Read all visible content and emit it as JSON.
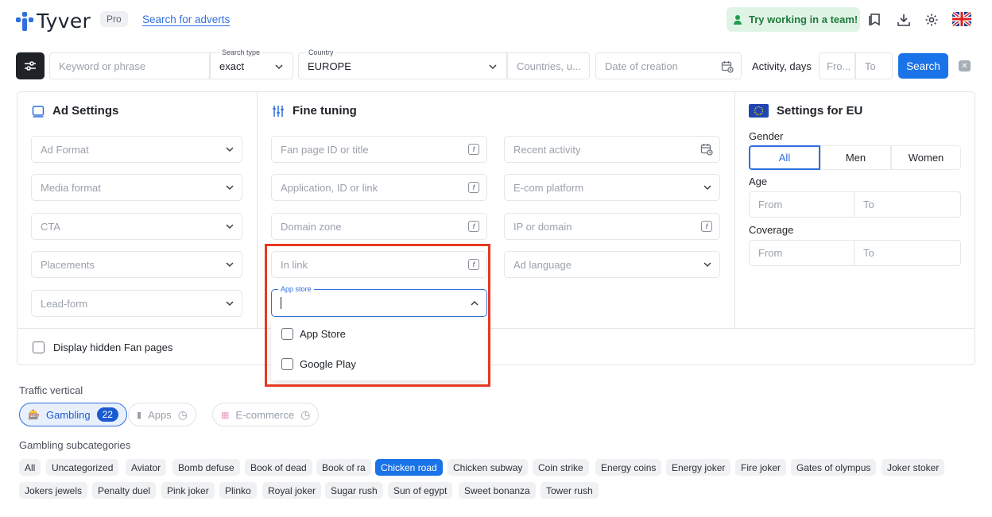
{
  "header": {
    "logo_text": "Tyver",
    "pro_badge": "Pro",
    "search_adverts_link": "Search for adverts",
    "team_button": "Try working in a team!",
    "icons": [
      "bookmark-icon",
      "download-icon",
      "gear-icon",
      "uk-flag-icon"
    ]
  },
  "search_bar": {
    "keyword_placeholder": "Keyword or phrase",
    "search_type_label": "Search type",
    "search_type_value": "exact",
    "country_label": "Country",
    "country_value": "EUROPE",
    "countries_placeholder": "Countries, u...",
    "date_placeholder": "Date of creation",
    "activity_label": "Activity, days",
    "activity_from": "Fro...",
    "activity_to": "To",
    "search_button": "Search"
  },
  "ad_settings": {
    "title": "Ad Settings",
    "fields": [
      "Ad Format",
      "Media format",
      "CTA",
      "Placements",
      "Lead-form"
    ]
  },
  "fine_tuning": {
    "title": "Fine tuning",
    "left_fields": [
      "Fan page ID or title",
      "Application, ID or link",
      "Domain zone",
      "In link"
    ],
    "right_fields": [
      "Recent activity",
      "E-com platform",
      "IP or domain",
      "Ad language"
    ],
    "app_store": {
      "label": "App store",
      "value": "",
      "options": [
        "App Store",
        "Google Play"
      ]
    }
  },
  "eu_settings": {
    "title": "Settings for EU",
    "gender_label": "Gender",
    "gender_options": [
      "All",
      "Men",
      "Women"
    ],
    "gender_selected": "All",
    "age_label": "Age",
    "age_from": "From",
    "age_to": "To",
    "coverage_label": "Coverage",
    "coverage_from": "From",
    "coverage_to": "To"
  },
  "hidden_fan_pages": "Display hidden Fan pages",
  "traffic": {
    "label": "Traffic vertical",
    "verticals": [
      {
        "label": "Gambling",
        "count": "22",
        "active": true
      },
      {
        "label": "Apps",
        "active": false
      },
      {
        "label": "E-commerce",
        "active": false
      }
    ]
  },
  "subcategories": {
    "label": "Gambling subcategories",
    "row1": [
      "All",
      "Uncategorized",
      "Aviator",
      "Bomb defuse",
      "Book of dead",
      "Book of ra",
      "Chicken road",
      "Chicken subway",
      "Coin strike",
      "Energy coins",
      "Energy joker",
      "Fire joker",
      "Gates of olympus",
      "Joker stoker"
    ],
    "row2": [
      "Jokers jewels",
      "Penalty duel",
      "Pink joker",
      "Plinko",
      "Royal joker",
      "Sugar rush",
      "Sun of egypt",
      "Sweet bonanza",
      "Tower rush"
    ],
    "selected": "Chicken road"
  },
  "colors": {
    "accent": "#1a73e8",
    "highlight": "#e53923",
    "team_bg": "#e0f4e6"
  }
}
